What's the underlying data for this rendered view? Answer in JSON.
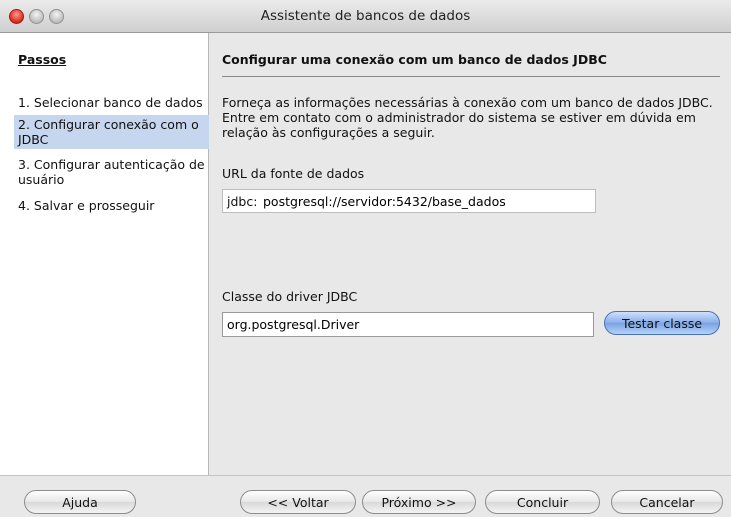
{
  "window": {
    "title": "Assistente de bancos de dados"
  },
  "steps": {
    "title": "Passos",
    "items": [
      {
        "label": "1. Selecionar banco de dados"
      },
      {
        "label": "2. Configurar conexão com o JDBC"
      },
      {
        "label": "3. Configurar autenticação de usuário"
      },
      {
        "label": "4. Salvar e prosseguir"
      }
    ]
  },
  "main": {
    "heading": "Configurar uma conexão com um banco de dados JDBC",
    "description": "Forneça as informações necessárias à conexão com um banco de dados JDBC. Entre em contato com o administrador do sistema se estiver em dúvida em relação às configurações a seguir.",
    "url_label": "URL da fonte de dados",
    "url_prefix": "jdbc:",
    "url_value": "postgresql://servidor:5432/base_dados",
    "driver_label": "Classe do driver JDBC",
    "driver_value": "org.postgresql.Driver",
    "test_button": "Testar classe"
  },
  "footer": {
    "help": "Ajuda",
    "back": "<< Voltar",
    "next": "Próximo >>",
    "finish": "Concluir",
    "cancel": "Cancelar"
  }
}
